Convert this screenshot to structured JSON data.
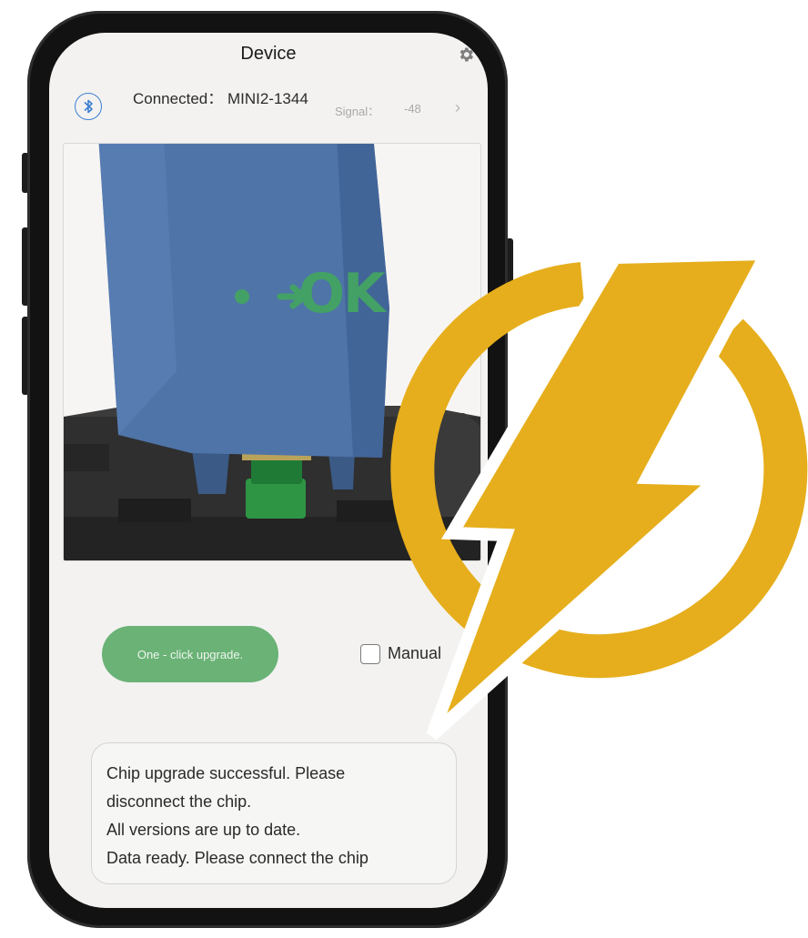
{
  "nav": {
    "title": "Device"
  },
  "connection": {
    "text": "Connected： MINI2-1344",
    "signal_label": "Signal：",
    "signal_value": "-48"
  },
  "image": {
    "ok_text": "OK"
  },
  "actions": {
    "upgrade_label": "One - click upgrade.",
    "manual_label": "Manual",
    "manual_checked": false
  },
  "log": {
    "lines": [
      "Chip upgrade successful. Please",
      "disconnect the chip.",
      "All versions are up to date.",
      "Data ready. Please connect the chip"
    ]
  },
  "colors": {
    "accent_green": "#6ab276",
    "ok_green": "#43a165",
    "bolt_gold": "#e6ae1c",
    "bluetooth_blue": "#3b7fd1"
  },
  "icons": [
    "gear-icon",
    "bluetooth-icon",
    "chevron-right-icon",
    "lightning-power-icon"
  ]
}
